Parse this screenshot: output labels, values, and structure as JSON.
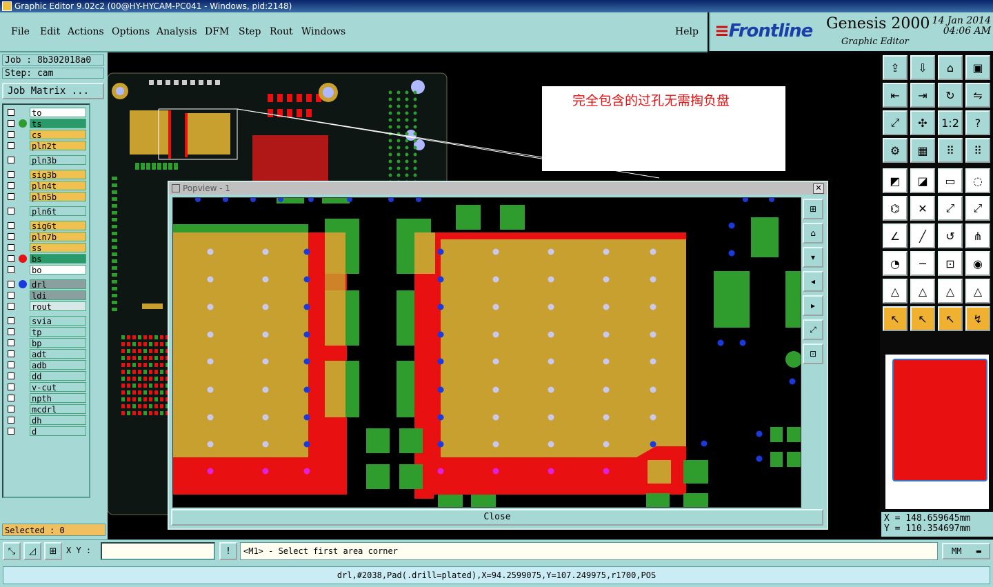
{
  "window": {
    "title": "Graphic Editor 9.02c2 (00@HY-HYCAM-PC041 - Windows, pid:2148)"
  },
  "menu": {
    "items": [
      {
        "label": "File"
      },
      {
        "label": "Edit"
      },
      {
        "label": "Actions"
      },
      {
        "label": "Options"
      },
      {
        "label": "Analysis"
      },
      {
        "label": "DFM"
      },
      {
        "label": "Step"
      },
      {
        "label": "Rout"
      },
      {
        "label": "Windows"
      },
      {
        "label": "Help"
      }
    ]
  },
  "brand": {
    "logo": "Frontline",
    "product": "Genesis 2000",
    "subtitle": "Graphic Editor",
    "date": "14 Jan 2014",
    "time": "04:06 AM"
  },
  "job": {
    "job_label": "Job : 8b302018a0",
    "step_label": "Step: cam",
    "matrix_button": "Job Matrix ..."
  },
  "layers": [
    {
      "name": "to",
      "color": "#ffffff"
    },
    {
      "name": "ts",
      "color": "#2a9a6a",
      "dot": "#2e9d2e"
    },
    {
      "name": "cs",
      "color": "#f0c050"
    },
    {
      "name": "pln2t",
      "color": "#f0c050"
    },
    {
      "name": "pln3b",
      "color": "#a6d9d5"
    },
    {
      "name": "sig3b",
      "color": "#f0c050"
    },
    {
      "name": "pln4t",
      "color": "#f0c050"
    },
    {
      "name": "pln5b",
      "color": "#f0c050"
    },
    {
      "name": "pln6t",
      "color": "#a6d9d5"
    },
    {
      "name": "sig6t",
      "color": "#f0c050"
    },
    {
      "name": "pln7b",
      "color": "#f0c050"
    },
    {
      "name": "ss",
      "color": "#f0c050"
    },
    {
      "name": "bs",
      "color": "#2a9a6a",
      "dot": "#e81010"
    },
    {
      "name": "bo",
      "color": "#ffffff"
    },
    {
      "name": "drl",
      "color": "#8aa0a0",
      "dot": "#1a3ae0"
    },
    {
      "name": "ldi",
      "color": "#8aa0a0"
    },
    {
      "name": "rout",
      "color": "#d8e8e8"
    },
    {
      "name": "svia",
      "color": "#a6d9d5"
    },
    {
      "name": "tp",
      "color": "#a6d9d5"
    },
    {
      "name": "bp",
      "color": "#a6d9d5"
    },
    {
      "name": "adt",
      "color": "#a6d9d5"
    },
    {
      "name": "adb",
      "color": "#a6d9d5"
    },
    {
      "name": "dd",
      "color": "#a6d9d5"
    },
    {
      "name": "v-cut",
      "color": "#a6d9d5"
    },
    {
      "name": "npth",
      "color": "#a6d9d5"
    },
    {
      "name": "mcdrl",
      "color": "#a6d9d5"
    },
    {
      "name": "dh",
      "color": "#a6d9d5"
    },
    {
      "name": "d",
      "color": "#a6d9d5"
    }
  ],
  "selected": "Selected : 0",
  "annotation": "完全包含的过孔无需掏负盘",
  "popview": {
    "title": "Popview - 1",
    "close_label": "Close"
  },
  "coords": {
    "x": "X =  148.659645mm",
    "y": "Y =  110.354697mm"
  },
  "xy_label": "X Y :",
  "xy_value": "",
  "prompt": "<M1> - Select first area corner",
  "units": "MM",
  "status": "drl,#2038,Pad(.drill=plated),X=94.2599075,Y=107.249975,r1700,POS",
  "icons": {
    "toolbar": [
      "home-icon",
      "zoom-icon",
      "pan-icon",
      "fit-icon",
      "snap-icon",
      "grid-icon",
      "measure-icon",
      "select-icon"
    ]
  }
}
